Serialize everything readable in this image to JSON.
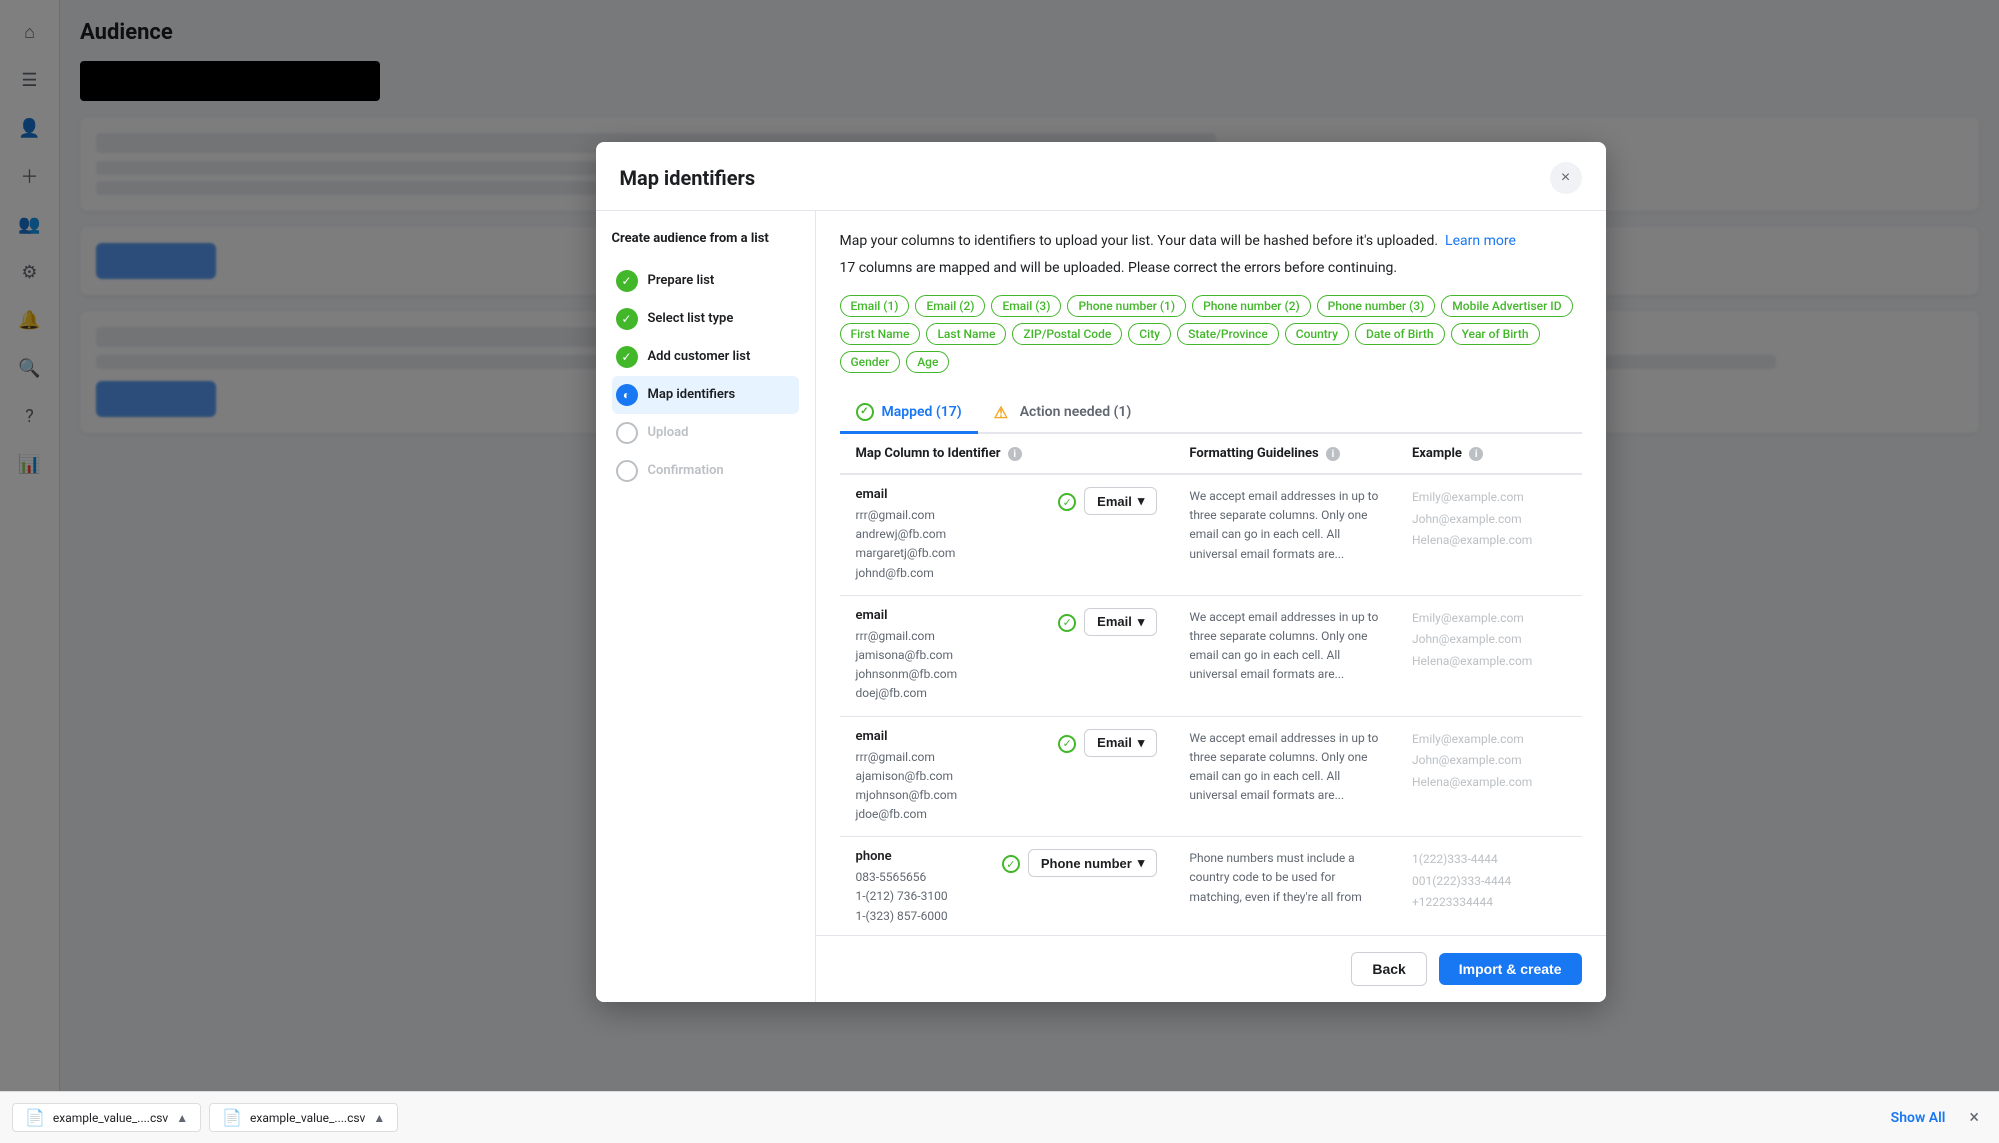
{
  "page": {
    "title": "Audience"
  },
  "sidebar": {
    "icons": [
      {
        "name": "home-icon",
        "symbol": "⌂",
        "active": false
      },
      {
        "name": "menu-icon",
        "symbol": "☰",
        "active": false
      },
      {
        "name": "avatar-icon",
        "symbol": "👤",
        "active": false
      },
      {
        "name": "add-icon",
        "symbol": "＋",
        "active": false
      },
      {
        "name": "audience-icon",
        "symbol": "👥",
        "active": true
      },
      {
        "name": "gear-icon",
        "symbol": "⚙",
        "active": false
      },
      {
        "name": "bell-icon",
        "symbol": "🔔",
        "active": false
      },
      {
        "name": "search-icon",
        "symbol": "🔍",
        "active": false
      },
      {
        "name": "help-icon",
        "symbol": "?",
        "active": false
      },
      {
        "name": "chart-icon",
        "symbol": "📊",
        "active": false
      }
    ]
  },
  "modal": {
    "title": "Map identifiers",
    "close_label": "×",
    "description": "Map your columns to identifiers to upload your list. Your data will be hashed before it's uploaded.",
    "learn_more": "Learn more",
    "count_message": "17 columns are mapped and will be uploaded. Please correct the errors before continuing.",
    "tags": [
      "Email (1)",
      "Email (2)",
      "Email (3)",
      "Phone number (1)",
      "Phone number (2)",
      "Phone number (3)",
      "Mobile Advertiser ID",
      "First Name",
      "Last Name",
      "ZIP/Postal Code",
      "City",
      "State/Province",
      "Country",
      "Date of Birth",
      "Year of Birth",
      "Gender",
      "Age"
    ],
    "tabs": [
      {
        "label": "Mapped (17)",
        "id": "mapped",
        "active": true,
        "icon": "check"
      },
      {
        "label": "Action needed (1)",
        "id": "action",
        "active": false,
        "icon": "warn"
      }
    ],
    "table": {
      "headers": [
        {
          "label": "Map Column to Identifier",
          "info": true
        },
        {
          "label": "Formatting Guidelines",
          "info": true
        },
        {
          "label": "Example",
          "info": true
        }
      ],
      "rows": [
        {
          "col_name": "email",
          "col_values": [
            "rrr@gmail.com",
            "andrewj@fb.com",
            "margaretj@fb.com",
            "johnd@fb.com"
          ],
          "identifier": "Email",
          "guidelines": "We accept email addresses in up to three separate columns. Only one email can go in each cell. All universal email formats are...",
          "examples": [
            "Emily@example.com",
            "John@example.com",
            "Helena@example.com"
          ]
        },
        {
          "col_name": "email",
          "col_values": [
            "rrr@gmail.com",
            "jamisona@fb.com",
            "johnsonm@fb.com",
            "doej@fb.com"
          ],
          "identifier": "Email",
          "guidelines": "We accept email addresses in up to three separate columns. Only one email can go in each cell. All universal email formats are...",
          "examples": [
            "Emily@example.com",
            "John@example.com",
            "Helena@example.com"
          ]
        },
        {
          "col_name": "email",
          "col_values": [
            "rrr@gmail.com",
            "ajamison@fb.com",
            "mjohnson@fb.com",
            "jdoe@fb.com"
          ],
          "identifier": "Email",
          "guidelines": "We accept email addresses in up to three separate columns. Only one email can go in each cell. All universal email formats are...",
          "examples": [
            "Emily@example.com",
            "John@example.com",
            "Helena@example.com"
          ]
        },
        {
          "col_name": "phone",
          "col_values": [
            "083-5565656",
            "1-(212) 736-3100",
            "1-(323) 857-6000"
          ],
          "identifier": "Phone number",
          "guidelines": "Phone numbers must include a country code to be used for matching, even if they're all from",
          "examples": [
            "1(222)333-4444",
            "001(222)333-4444",
            "+12223334444"
          ]
        }
      ]
    },
    "footer": {
      "back_label": "Back",
      "primary_label": "Import & create"
    }
  },
  "steps_panel": {
    "title": "Create audience from a list",
    "steps": [
      {
        "label": "Prepare list",
        "status": "done"
      },
      {
        "label": "Select list type",
        "status": "done"
      },
      {
        "label": "Add customer list",
        "status": "done"
      },
      {
        "label": "Map identifiers",
        "status": "current"
      },
      {
        "label": "Upload",
        "status": "pending"
      },
      {
        "label": "Confirmation",
        "status": "pending"
      }
    ]
  },
  "bottom_bar": {
    "files": [
      {
        "name": "example_value_....csv",
        "icon": "📄"
      },
      {
        "name": "example_value_....csv",
        "icon": "📄"
      }
    ],
    "show_all_label": "Show All",
    "close_label": "×"
  }
}
